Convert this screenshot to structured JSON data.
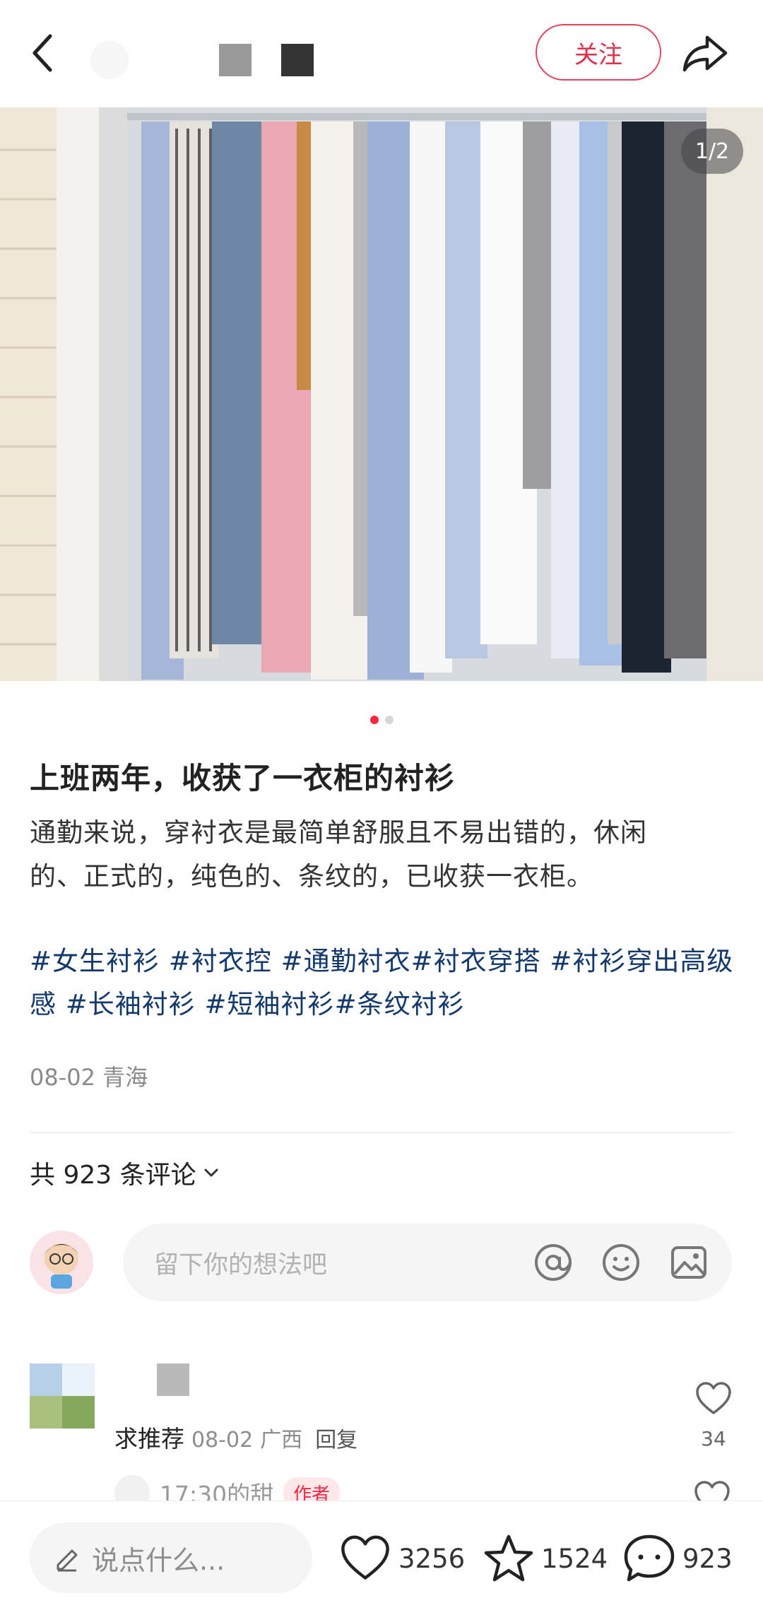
{
  "header": {
    "back_icon": "chevron-left-icon",
    "follow_label": "关注",
    "share_icon": "share-arrow-icon"
  },
  "image": {
    "counter": "1/2",
    "total": 2,
    "current": 1
  },
  "note": {
    "title": "上班两年，收获了一衣柜的衬衫",
    "desc_line1": "通勤来说，穿衬衣是最简单舒服且不易出错的，休闲",
    "desc_line2": "的、正式的，纯色的、条纹的，已收获一衣柜。",
    "tags": [
      "#女生衬衫",
      "#衬衣控",
      "#通勤衬衣",
      "#衬衣穿搭",
      "#衬衫穿出高级感",
      "#长袖衬衫",
      "#短袖衬衫",
      "#条纹衬衫"
    ],
    "meta": "08-02 青海"
  },
  "comments": {
    "count_label": "共 923 条评论",
    "input_placeholder": "留下你的想法吧",
    "input_icons": [
      "at-icon",
      "emoji-icon",
      "image-icon"
    ],
    "items": [
      {
        "text": "求推荐",
        "time": "08-02",
        "location": "广西",
        "reply_label": "回复",
        "likes": "34"
      }
    ],
    "sub_reply": {
      "name": "17:30的甜",
      "badge": "作者"
    }
  },
  "bottom": {
    "placeholder": "说点什么...",
    "likes": "3256",
    "favorites": "1524",
    "comments": "923"
  },
  "colors": {
    "accent": "#ff2442",
    "tag": "#13386c"
  }
}
